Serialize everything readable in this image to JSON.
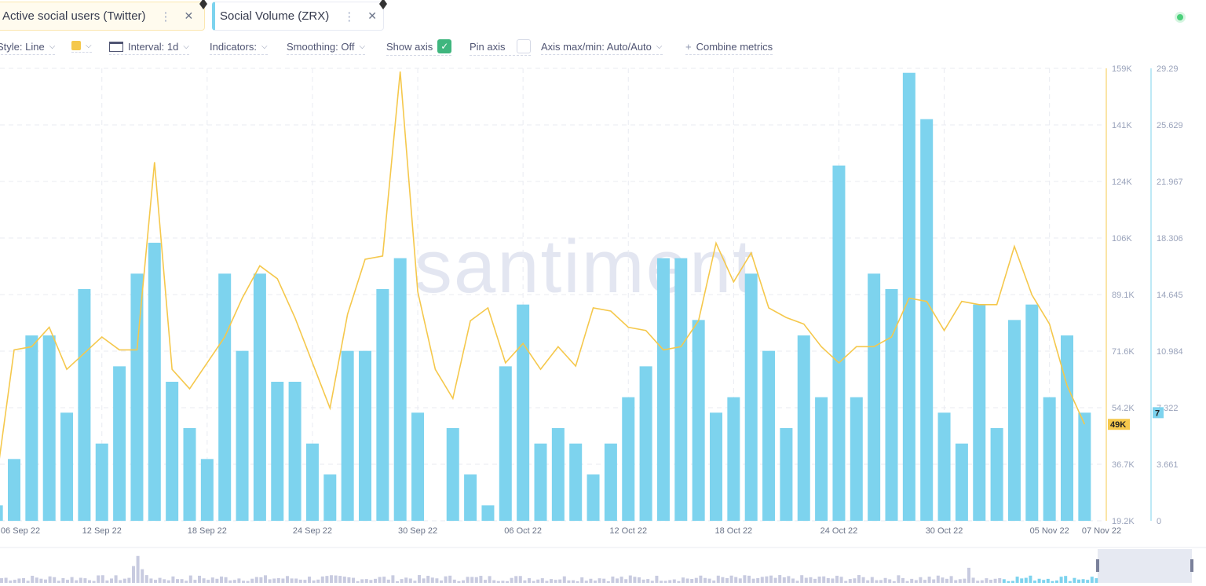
{
  "tabs": [
    {
      "label": "Active social users (Twitter)",
      "color": "#f5c84c"
    },
    {
      "label": "Social Volume (ZRX)",
      "color": "#7dd3ee"
    }
  ],
  "toolbar": {
    "style": "Style: Line",
    "interval": "Interval: 1d",
    "indicators": "Indicators:",
    "smoothing": "Smoothing: Off",
    "show_axis": "Show axis",
    "show_axis_checked": true,
    "pin_axis": "Pin axis",
    "pin_axis_checked": false,
    "axis_maxmin": "Axis max/min: Auto/Auto",
    "combine": "Combine metrics"
  },
  "status_color": "#4bd07a",
  "watermark": "santiment",
  "chart_data": {
    "type": "bar+line",
    "dates": [
      "06 Sep",
      "07 Sep",
      "08 Sep",
      "09 Sep",
      "10 Sep",
      "11 Sep",
      "12 Sep",
      "13 Sep",
      "14 Sep",
      "15 Sep",
      "16 Sep",
      "17 Sep",
      "18 Sep",
      "19 Sep",
      "20 Sep",
      "21 Sep",
      "22 Sep",
      "23 Sep",
      "24 Sep",
      "25 Sep",
      "26 Sep",
      "27 Sep",
      "28 Sep",
      "29 Sep",
      "30 Sep",
      "01 Oct",
      "02 Oct",
      "03 Oct",
      "04 Oct",
      "05 Oct",
      "06 Oct",
      "07 Oct",
      "08 Oct",
      "09 Oct",
      "10 Oct",
      "11 Oct",
      "12 Oct",
      "13 Oct",
      "14 Oct",
      "15 Oct",
      "16 Oct",
      "17 Oct",
      "18 Oct",
      "19 Oct",
      "20 Oct",
      "21 Oct",
      "22 Oct",
      "23 Oct",
      "24 Oct",
      "25 Oct",
      "26 Oct",
      "27 Oct",
      "28 Oct",
      "29 Oct",
      "30 Oct",
      "31 Oct",
      "01 Nov",
      "02 Nov",
      "03 Nov",
      "04 Nov",
      "05 Nov",
      "06 Nov",
      "07 Nov"
    ],
    "series": [
      {
        "name": "Social Volume (ZRX)",
        "type": "bar",
        "axis": "right",
        "color": "#7dd3ee",
        "values": [
          1,
          4,
          12,
          12,
          7,
          15,
          5,
          10,
          16,
          18,
          9,
          6,
          4,
          16,
          11,
          16,
          9,
          9,
          5,
          3,
          11,
          11,
          15,
          17,
          7,
          0,
          6,
          3,
          1,
          10,
          14,
          5,
          6,
          5,
          3,
          5,
          8,
          10,
          17,
          17,
          13,
          7,
          8,
          16,
          11,
          6,
          12,
          8,
          23,
          8,
          16,
          15,
          29,
          26,
          7,
          5,
          14,
          6,
          13,
          14,
          8,
          12,
          7
        ]
      },
      {
        "name": "Active social users (Twitter)",
        "type": "line",
        "axis": "left",
        "color": "#f5c84c",
        "values": [
          32,
          72,
          73,
          79,
          66,
          71,
          76,
          72,
          72,
          130,
          66,
          60,
          68,
          76,
          88,
          98,
          94,
          82,
          68,
          54,
          83,
          100,
          101,
          158,
          90,
          66,
          57,
          81,
          85,
          68,
          74,
          66,
          73,
          67,
          85,
          84,
          79,
          78,
          72,
          73,
          81,
          105,
          93,
          102,
          85,
          82,
          80,
          73,
          68,
          73,
          73,
          76,
          88,
          87,
          78,
          87,
          86,
          86,
          104,
          89,
          80,
          61,
          49
        ]
      }
    ],
    "x_ticks": [
      "06 Sep 22",
      "12 Sep 22",
      "18 Sep 22",
      "24 Sep 22",
      "30 Sep 22",
      "06 Oct 22",
      "12 Oct 22",
      "18 Oct 22",
      "24 Oct 22",
      "30 Oct 22",
      "05 Nov 22",
      "07 Nov 22"
    ],
    "left_axis": {
      "ticks": [
        "159K",
        "141K",
        "124K",
        "106K",
        "89.1K",
        "71.6K",
        "54.2K",
        "36.7K",
        "19.2K"
      ],
      "range": [
        19.2,
        159
      ],
      "unit": "K",
      "last_label": "49K"
    },
    "right_axis": {
      "ticks": [
        "29.29",
        "25.629",
        "21.967",
        "18.306",
        "14.645",
        "10.984",
        "7.322",
        "3.661",
        "0"
      ],
      "range": [
        0,
        29.29
      ],
      "last_label": "7"
    }
  }
}
